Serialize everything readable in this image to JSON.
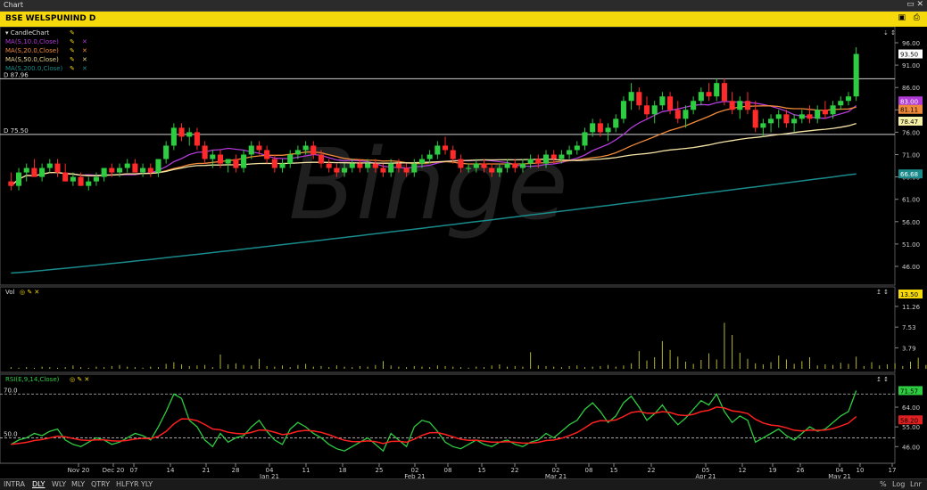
{
  "window": {
    "title": "Chart"
  },
  "symbol": {
    "label": "BSE WELSPUNIND D"
  },
  "price_legend": [
    {
      "label": "CandleChart",
      "color": "#2ecc40"
    },
    {
      "label": "MA(S,10.0,Close)",
      "color": "#b03bd6"
    },
    {
      "label": "MA(S,20.0,Close)",
      "color": "#f08a3a"
    },
    {
      "label": "MA(S,50.0,Close)",
      "color": "#e6d38a"
    },
    {
      "label": "MA(S,200.0,Close)",
      "color": "#1a8a8a"
    }
  ],
  "vol_legend": {
    "label": "Vol"
  },
  "rsi_legend": {
    "label": "RSI(E,9,14,Close)"
  },
  "price_panel": {
    "hline_labels": [
      "D 87.96",
      "D 75.50"
    ],
    "yticks": [
      "96.00",
      "91.00",
      "86.00",
      "81.00",
      "76.00",
      "71.00",
      "66.00",
      "61.00",
      "56.00",
      "51.00",
      "46.00"
    ],
    "badges": [
      {
        "text": "93.50",
        "bg": "#ffffff",
        "fg": "#000000"
      },
      {
        "text": "83.00",
        "bg": "#b03bd6",
        "fg": "#ffffff"
      },
      {
        "text": "81.11",
        "bg": "#f08a3a",
        "fg": "#000000"
      },
      {
        "text": "78.47",
        "bg": "#f6f1a6",
        "fg": "#000000"
      },
      {
        "text": "66.68",
        "bg": "#1a8a8a",
        "fg": "#ffffff"
      }
    ]
  },
  "vol_panel": {
    "yticks": [
      "11.26",
      "7.53",
      "3.79"
    ],
    "badge": "13.50"
  },
  "rsi_panel": {
    "yticks_left": [
      "70.0",
      "50.0"
    ],
    "yticks_right": [
      "64.00",
      "55.00",
      "46.00"
    ],
    "badges": [
      {
        "text": "71.57",
        "bg": "#2ecc40"
      },
      {
        "text": "58.20",
        "bg": "#e02020"
      }
    ]
  },
  "xaxis": {
    "ticks": [
      "Nov 20",
      "Dec 20",
      "07",
      "14",
      "21",
      "28",
      "04",
      "11",
      "18",
      "25",
      "02",
      "08",
      "15",
      "22",
      "02",
      "08",
      "15",
      "22",
      "05",
      "12",
      "19",
      "26",
      "04",
      "10",
      "17"
    ],
    "month_labels": [
      "Jan 21",
      "Feb 21",
      "Mar 21",
      "Apr 21",
      "May 21"
    ]
  },
  "bottom_buttons": [
    "INTRA",
    "DLY",
    "WLY",
    "MLY",
    "QTRY",
    "HLFYR",
    "YLY"
  ],
  "bottom_right": [
    "%",
    "Log",
    "Lnr"
  ],
  "watermark": "Binge",
  "chart_data": {
    "type": "candlestick",
    "title": "BSE WELSPUNIND D",
    "ylim": [
      42,
      98
    ],
    "candles": [
      [
        65,
        67,
        63,
        64
      ],
      [
        64,
        68,
        63,
        67
      ],
      [
        67,
        69,
        65,
        68
      ],
      [
        68,
        70,
        66,
        66
      ],
      [
        66,
        69,
        65,
        68
      ],
      [
        68,
        70,
        67,
        69
      ],
      [
        69,
        70,
        66,
        67
      ],
      [
        67,
        69,
        65,
        65
      ],
      [
        65,
        67,
        64,
        66
      ],
      [
        66,
        67,
        64,
        64
      ],
      [
        64,
        66,
        63,
        65
      ],
      [
        65,
        67,
        64,
        66
      ],
      [
        66,
        68,
        65,
        68
      ],
      [
        68,
        69,
        66,
        67
      ],
      [
        67,
        69,
        66,
        68
      ],
      [
        68,
        70,
        67,
        69
      ],
      [
        69,
        70,
        67,
        67
      ],
      [
        67,
        69,
        66,
        68
      ],
      [
        68,
        69,
        66,
        67
      ],
      [
        67,
        70,
        66,
        70
      ],
      [
        70,
        74,
        69,
        73
      ],
      [
        73,
        78,
        72,
        77
      ],
      [
        77,
        78,
        74,
        75
      ],
      [
        75,
        77,
        73,
        76
      ],
      [
        76,
        77,
        72,
        73
      ],
      [
        73,
        74,
        69,
        70
      ],
      [
        70,
        72,
        68,
        71
      ],
      [
        71,
        72,
        68,
        69
      ],
      [
        69,
        70,
        67,
        70
      ],
      [
        70,
        71,
        67,
        68
      ],
      [
        68,
        72,
        67,
        71
      ],
      [
        71,
        74,
        70,
        73
      ],
      [
        73,
        74,
        71,
        72
      ],
      [
        72,
        73,
        69,
        70
      ],
      [
        70,
        71,
        67,
        68
      ],
      [
        68,
        70,
        67,
        69
      ],
      [
        69,
        72,
        68,
        71
      ],
      [
        71,
        73,
        70,
        72
      ],
      [
        72,
        74,
        71,
        73
      ],
      [
        73,
        74,
        70,
        71
      ],
      [
        71,
        72,
        68,
        69
      ],
      [
        69,
        70,
        67,
        68
      ],
      [
        68,
        69,
        66,
        67
      ],
      [
        67,
        69,
        66,
        68
      ],
      [
        68,
        70,
        67,
        69
      ],
      [
        69,
        70,
        67,
        68
      ],
      [
        68,
        70,
        67,
        69
      ],
      [
        69,
        70,
        67,
        68
      ],
      [
        68,
        69,
        66,
        67
      ],
      [
        67,
        70,
        66,
        69
      ],
      [
        69,
        70,
        67,
        68
      ],
      [
        68,
        69,
        66,
        67
      ],
      [
        67,
        70,
        66,
        69
      ],
      [
        69,
        71,
        68,
        70
      ],
      [
        70,
        72,
        69,
        71
      ],
      [
        71,
        74,
        70,
        73
      ],
      [
        73,
        75,
        71,
        72
      ],
      [
        72,
        73,
        69,
        70
      ],
      [
        70,
        71,
        67,
        68
      ],
      [
        68,
        69,
        67,
        68
      ],
      [
        68,
        70,
        67,
        69
      ],
      [
        69,
        70,
        67,
        68
      ],
      [
        68,
        69,
        66,
        67
      ],
      [
        67,
        69,
        66,
        68
      ],
      [
        68,
        70,
        67,
        69
      ],
      [
        69,
        70,
        67,
        68
      ],
      [
        68,
        70,
        67,
        69
      ],
      [
        69,
        71,
        68,
        70
      ],
      [
        70,
        71,
        68,
        69
      ],
      [
        69,
        72,
        68,
        71
      ],
      [
        71,
        72,
        69,
        70
      ],
      [
        70,
        72,
        69,
        71
      ],
      [
        71,
        73,
        70,
        72
      ],
      [
        72,
        74,
        71,
        73
      ],
      [
        73,
        77,
        72,
        76
      ],
      [
        76,
        79,
        75,
        78
      ],
      [
        78,
        79,
        75,
        76
      ],
      [
        76,
        78,
        74,
        77
      ],
      [
        77,
        80,
        76,
        79
      ],
      [
        79,
        84,
        78,
        83
      ],
      [
        83,
        87,
        81,
        85
      ],
      [
        85,
        86,
        81,
        82
      ],
      [
        82,
        84,
        79,
        80
      ],
      [
        80,
        83,
        78,
        82
      ],
      [
        82,
        85,
        81,
        84
      ],
      [
        84,
        85,
        80,
        81
      ],
      [
        81,
        83,
        78,
        79
      ],
      [
        79,
        82,
        77,
        81
      ],
      [
        81,
        84,
        80,
        83
      ],
      [
        83,
        86,
        82,
        85
      ],
      [
        85,
        87,
        83,
        84
      ],
      [
        84,
        88,
        83,
        87
      ],
      [
        87,
        88,
        82,
        83
      ],
      [
        83,
        85,
        80,
        81
      ],
      [
        81,
        84,
        79,
        83
      ],
      [
        83,
        85,
        80,
        81
      ],
      [
        81,
        83,
        76,
        77
      ],
      [
        77,
        79,
        75,
        78
      ],
      [
        78,
        80,
        76,
        79
      ],
      [
        79,
        81,
        77,
        80
      ],
      [
        80,
        81,
        77,
        78
      ],
      [
        78,
        80,
        76,
        79
      ],
      [
        79,
        81,
        78,
        80
      ],
      [
        80,
        82,
        78,
        79
      ],
      [
        79,
        82,
        78,
        81
      ],
      [
        81,
        83,
        79,
        80
      ],
      [
        80,
        83,
        79,
        82
      ],
      [
        82,
        84,
        81,
        83
      ],
      [
        83,
        85,
        82,
        84
      ],
      [
        84,
        95,
        83,
        93.5
      ]
    ],
    "ma10_last": 83.0,
    "ma20_last": 81.11,
    "ma50_last": 78.47,
    "ma200_range": [
      44.5,
      66.68
    ],
    "volume": [
      0.3,
      0.2,
      0.3,
      0.2,
      0.4,
      0.3,
      0.2,
      0.3,
      0.6,
      0.3,
      0.2,
      0.4,
      0.3,
      0.5,
      0.7,
      0.4,
      0.3,
      0.2,
      0.4,
      0.3,
      0.9,
      1.2,
      0.8,
      0.5,
      0.6,
      0.7,
      0.3,
      2.6,
      0.8,
      1.0,
      0.7,
      0.6,
      1.8,
      0.5,
      0.4,
      0.6,
      0.3,
      0.7,
      0.9,
      0.4,
      0.5,
      0.3,
      0.6,
      0.4,
      0.3,
      0.5,
      0.4,
      0.7,
      1.4,
      0.6,
      0.4,
      0.3,
      0.5,
      0.4,
      0.3,
      0.6,
      0.5,
      0.4,
      0.3,
      0.2,
      0.4,
      0.3,
      0.6,
      0.8,
      0.4,
      0.5,
      0.4,
      3.0,
      0.6,
      0.5,
      0.4,
      0.3,
      0.5,
      0.6,
      0.3,
      0.4,
      0.5,
      0.7,
      0.4,
      0.6,
      1.0,
      3.2,
      1.5,
      2.1,
      5.0,
      3.4,
      2.2,
      1.3,
      0.9,
      1.6,
      2.8,
      1.7,
      8.3,
      6.1,
      2.9,
      1.8,
      1.0,
      0.8,
      1.2,
      2.4,
      1.7,
      0.9,
      1.4,
      2.1,
      0.6,
      0.8,
      0.7,
      1.1,
      0.9,
      2.2,
      0.5,
      1.2,
      0.6,
      0.8,
      1.0,
      0.5,
      1.3,
      2.0,
      0.7,
      1.1,
      0.8,
      0.6,
      1.0,
      0.5,
      0.9,
      0.7,
      0.6,
      1.2,
      0.8,
      0.9,
      13.5
    ],
    "rsi": [
      47,
      49,
      50,
      52,
      51,
      53,
      54,
      49,
      47,
      46,
      48,
      50,
      49,
      47,
      48,
      50,
      52,
      51,
      49,
      55,
      62,
      70,
      68,
      58,
      55,
      49,
      46,
      52,
      48,
      50,
      51,
      55,
      58,
      53,
      49,
      47,
      54,
      57,
      55,
      52,
      50,
      47,
      45,
      44,
      46,
      48,
      50,
      47,
      44,
      52,
      49,
      46,
      55,
      58,
      57,
      53,
      48,
      46,
      45,
      47,
      49,
      47,
      46,
      48,
      49,
      47,
      46,
      48,
      49,
      52,
      50,
      53,
      56,
      58,
      63,
      66,
      62,
      57,
      60,
      66,
      69,
      64,
      58,
      61,
      65,
      60,
      56,
      59,
      63,
      67,
      65,
      70,
      62,
      57,
      60,
      58,
      48,
      50,
      52,
      54,
      51,
      49,
      52,
      55,
      53,
      54,
      57,
      60,
      62,
      71.57
    ],
    "rsi_signal_last": 58.2
  }
}
